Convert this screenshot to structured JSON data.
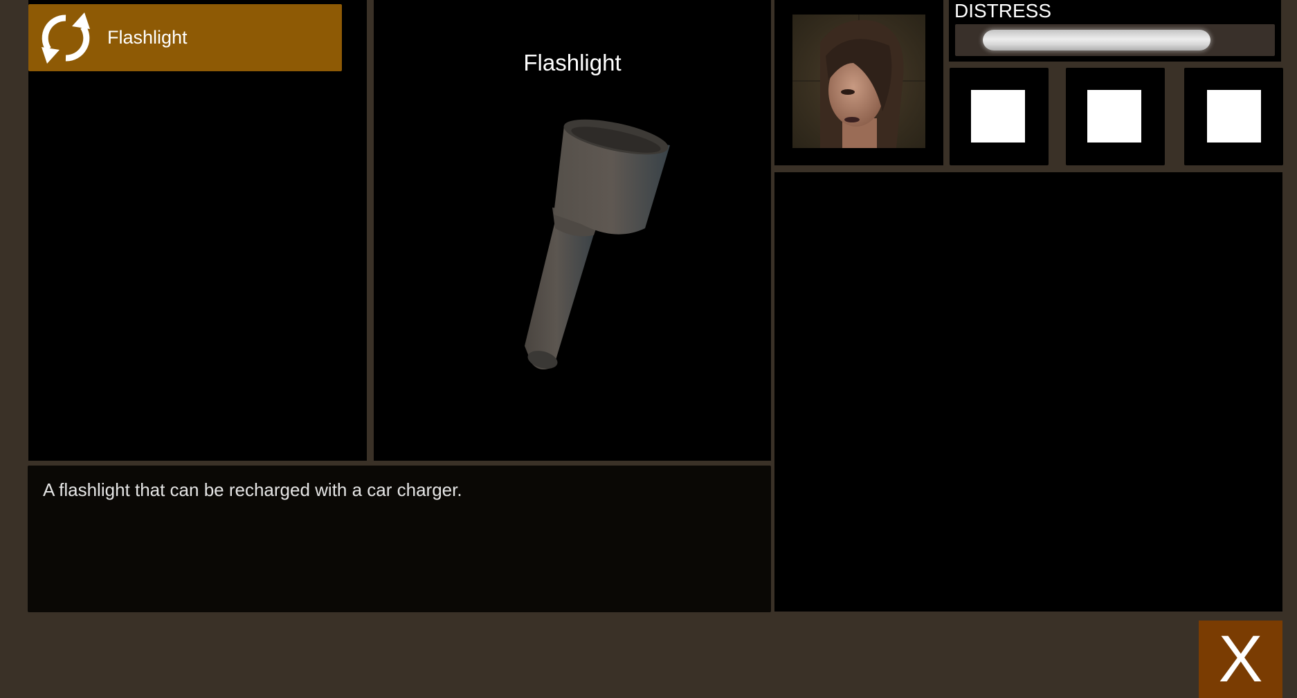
{
  "inventory": {
    "items": [
      {
        "label": "Flashlight",
        "icon": "cycle-arrows-icon",
        "selected": true
      }
    ]
  },
  "preview": {
    "title": "Flashlight",
    "model": "flashlight-model"
  },
  "description": {
    "text": "A flashlight that can be recharged with a car charger."
  },
  "status": {
    "distress_label": "DISTRESS",
    "distress_level": 0.86
  },
  "close_button": {
    "label": "X"
  },
  "colors": {
    "background": "#3a3127",
    "panel": "#000000",
    "selected_item": "#8e5a05",
    "close_button": "#7a3c02"
  }
}
